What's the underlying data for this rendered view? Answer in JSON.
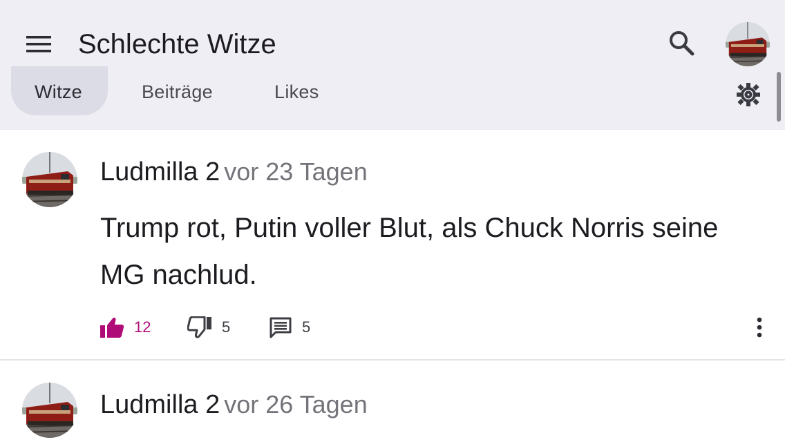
{
  "header": {
    "title": "Schlechte Witze",
    "menu_icon": "menu-icon",
    "search_icon": "search-icon",
    "profile_avatar": "train-avatar"
  },
  "tabs": [
    {
      "label": "Witze",
      "selected": true
    },
    {
      "label": "Beiträge",
      "selected": false
    },
    {
      "label": "Likes",
      "selected": false
    }
  ],
  "settings_icon": "gear-icon",
  "colors": {
    "appbar_bg": "#efeef4",
    "tab_selected_bg": "#dcdce6",
    "like_active": "#b00c78",
    "secondary_text": "#74737a"
  },
  "posts": [
    {
      "author": "Ludmilla 2",
      "time": "vor 23 Tagen",
      "text": "Trump rot, Putin voller Blut, als Chuck Norris seine MG nachlud.",
      "likes": "12",
      "dislikes": "5",
      "comments": "5",
      "liked": true
    },
    {
      "author": "Ludmilla 2",
      "time": "vor 26 Tagen"
    }
  ]
}
